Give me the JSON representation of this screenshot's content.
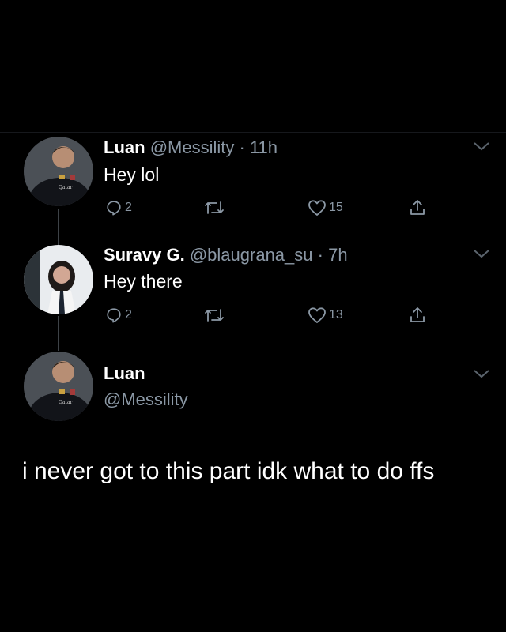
{
  "theme": {
    "background": "#000000",
    "text": "#ffffff",
    "secondary_text": "#8b98a5",
    "thread_line": "#3d4247"
  },
  "tweets": [
    {
      "name": "Luan",
      "handle": "@Messility",
      "separator": "·",
      "time": "11h",
      "text": "Hey lol",
      "replies": "2",
      "likes": "15",
      "avatar": "avatar-luan"
    },
    {
      "name": "Suravy G.",
      "handle": "@blaugrana_su",
      "separator": "·",
      "time": "7h",
      "text": "Hey there",
      "replies": "2",
      "likes": "13",
      "avatar": "avatar-suravy"
    }
  ],
  "focus": {
    "name": "Luan",
    "handle": "@Messility",
    "text": "i never got to this part idk what to do ffs",
    "avatar": "avatar-luan"
  },
  "icons": {
    "reply": "reply-icon",
    "retweet": "retweet-icon",
    "like": "heart-icon",
    "share": "share-icon",
    "more": "chevron-down-icon"
  }
}
